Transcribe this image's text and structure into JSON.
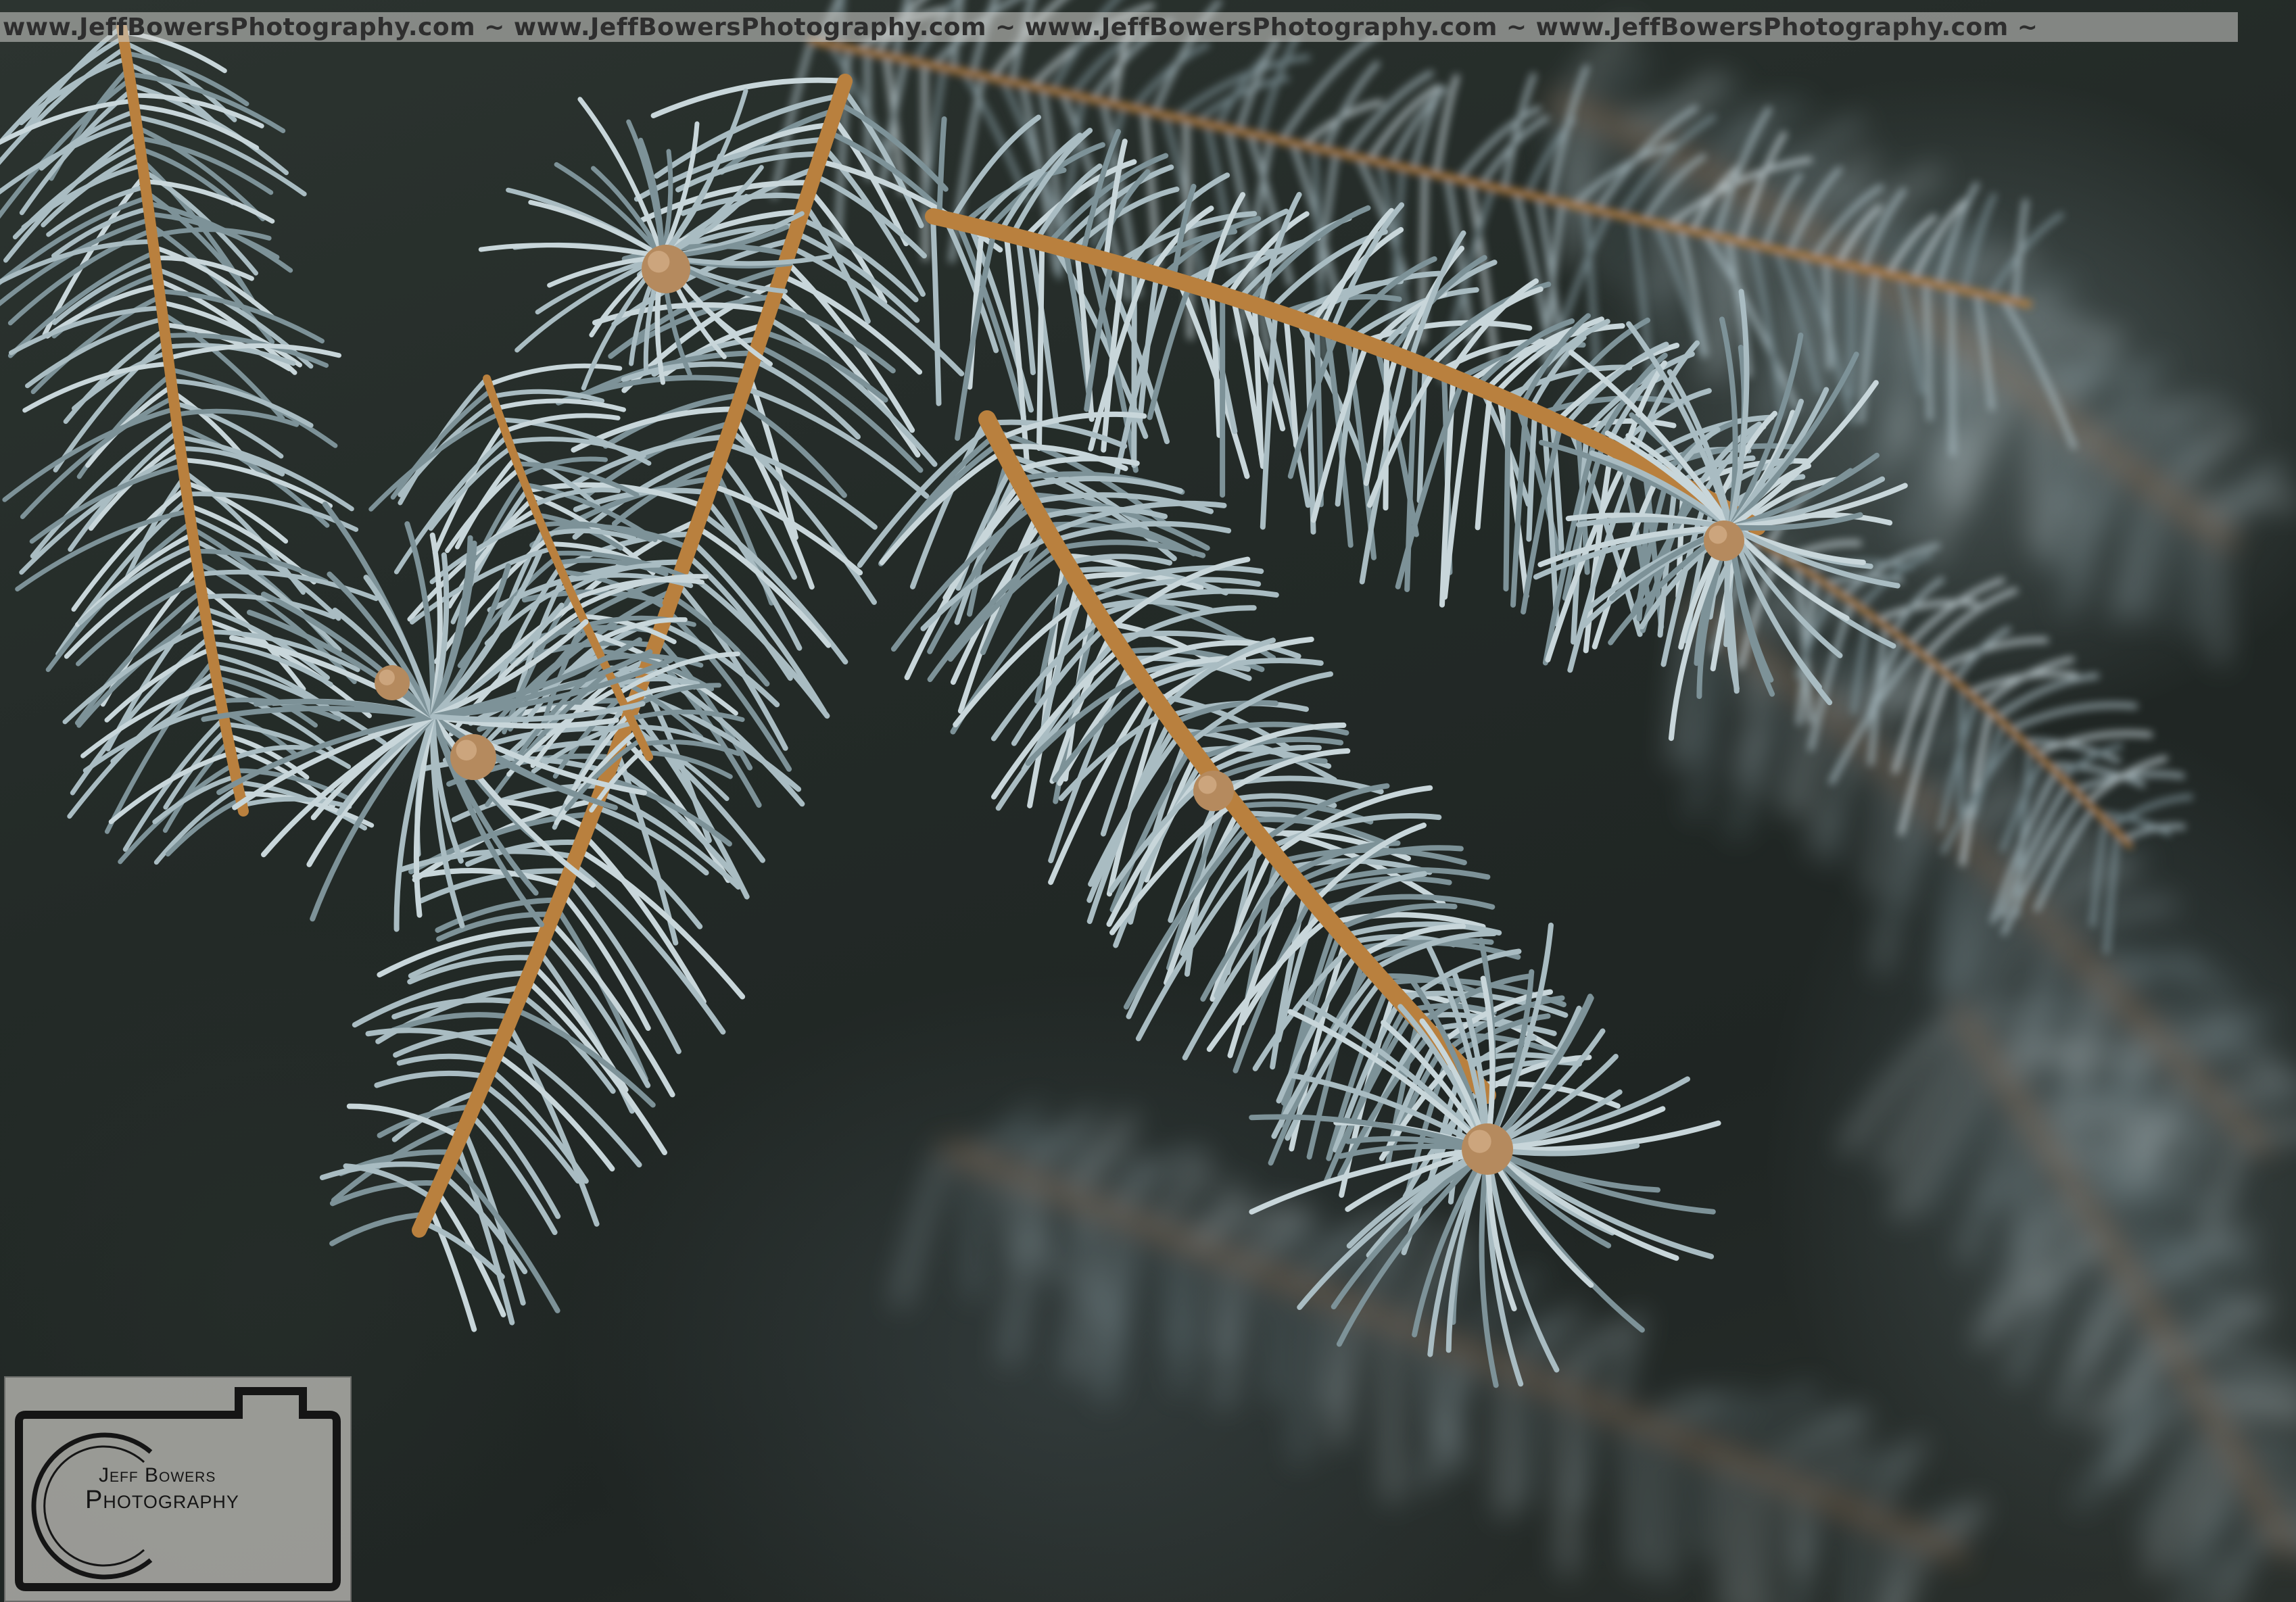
{
  "watermark": {
    "text": "www.JeffBowersPhotography.com ~ www.JeffBowersPhotography.com ~ www.JeffBowersPhotography.com ~ www.JeffBowersPhotography.com ~"
  },
  "logo": {
    "line1": "Jeff Bowers",
    "line2": "Photography"
  },
  "colors": {
    "needle": "#a9bcc2",
    "needle_light": "#c8d6da",
    "needle_dark": "#7d9298",
    "twig": "#b9803e",
    "bud": "#b58a5e",
    "background": "#232a27"
  }
}
